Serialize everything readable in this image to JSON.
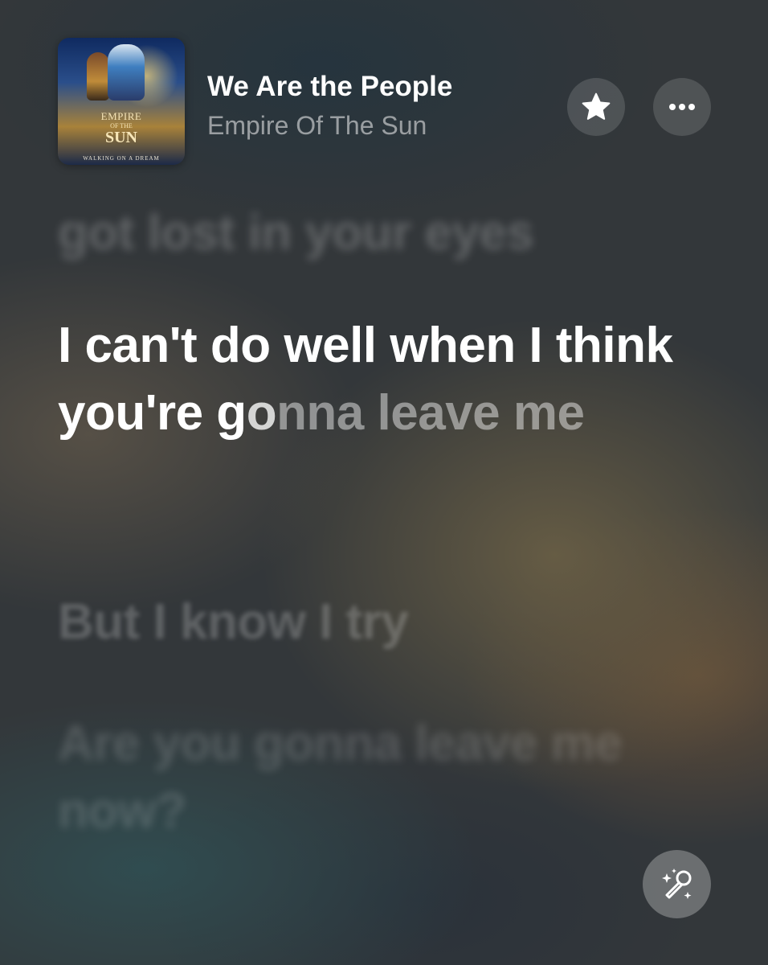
{
  "now_playing": {
    "song_title": "We Are the People",
    "artist": "Empire Of The Sun",
    "cover_art": {
      "line1": "EMPIRE",
      "line2": "OF THE",
      "line3": "SUN",
      "subtitle": "WALKING ON A DREAM"
    }
  },
  "actions": {
    "favorite_icon": "star-icon",
    "more_icon": "ellipsis-icon",
    "sing_icon": "microphone-sparkle-icon"
  },
  "lyrics": {
    "previous_line": "got lost in your eyes",
    "current_line": {
      "sung": "I can't do well when I think you're g",
      "singing": "o",
      "unsung": "nna leave me"
    },
    "next_lines": [
      "But I know I try",
      "Are you gonna leave me now?"
    ]
  },
  "colors": {
    "lyric_active": "#ffffff",
    "button_fill": "rgba(255,255,255,0.14)"
  }
}
